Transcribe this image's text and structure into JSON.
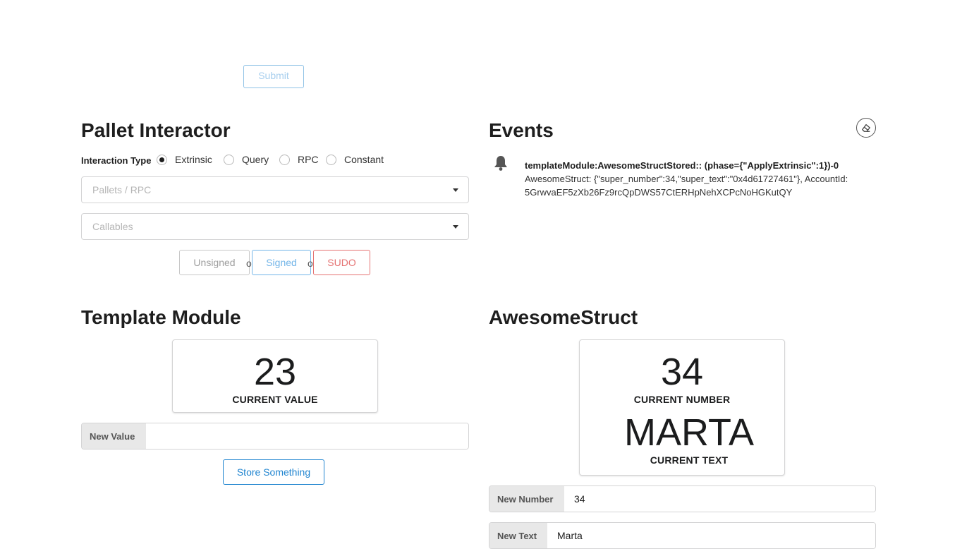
{
  "top": {
    "submit_label": "Submit"
  },
  "pallet": {
    "title": "Pallet Interactor",
    "interaction_type_label": "Interaction Type",
    "options": [
      {
        "label": "Extrinsic",
        "selected": true
      },
      {
        "label": "Query",
        "selected": false
      },
      {
        "label": "RPC",
        "selected": false
      },
      {
        "label": "Constant",
        "selected": false
      }
    ],
    "pallets_placeholder": "Pallets / RPC",
    "callables_placeholder": "Callables",
    "buttons": {
      "unsigned": "Unsigned",
      "signed": "Signed",
      "sudo": "SUDO",
      "or": "or"
    }
  },
  "events": {
    "title": "Events",
    "items": [
      {
        "title": "templateModule:AwesomeStructStored:: (phase={\"ApplyExtrinsic\":1})-0",
        "line1": "AwesomeStruct: {\"super_number\":34,\"super_text\":\"0x4d61727461\"}, AccountId:",
        "line2": "5GrwvaEF5zXb26Fz9rcQpDWS57CtERHpNehXCPcNoHGKutQY"
      }
    ]
  },
  "template_module": {
    "title": "Template Module",
    "value": "23",
    "value_label": "CURRENT VALUE",
    "input_label": "New Value",
    "input_value": "",
    "button_label": "Store Something"
  },
  "awesome_struct": {
    "title": "AwesomeStruct",
    "number": "34",
    "number_label": "CURRENT NUMBER",
    "text": "MARTA",
    "text_label": "CURRENT TEXT",
    "number_input_label": "New Number",
    "number_input_value": "34",
    "text_input_label": "New Text",
    "text_input_value": "Marta"
  },
  "colors": {
    "signed": "#73b5e8",
    "sudo": "#e57373",
    "unsigned": "#9e9e9e",
    "primary": "#2185d0"
  }
}
